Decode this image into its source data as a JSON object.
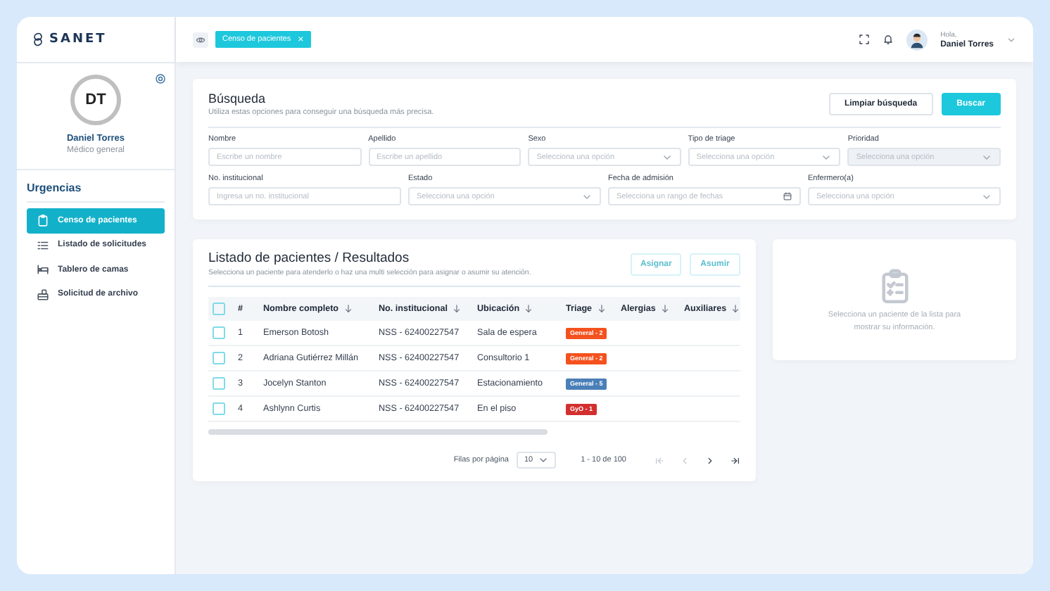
{
  "app": {
    "logo": "SANET"
  },
  "tabs": [
    {
      "label": "Censo de pacientes",
      "selected": true,
      "close": "×"
    }
  ],
  "header": {
    "greeting": "Hola,",
    "user_name": "Daniel Torres"
  },
  "profile": {
    "initials": "DT",
    "name": "Daniel Torres",
    "role": "Médico general"
  },
  "sidebar": {
    "section": "Urgencias",
    "items": [
      {
        "label": "Censo de pacientes",
        "kind": "clipboard",
        "selected": true
      },
      {
        "label": "Listado de solicitudes",
        "kind": "list",
        "selected": false
      },
      {
        "label": "Tablero de camas",
        "kind": "bed",
        "selected": false
      },
      {
        "label": "Solicitud de archivo",
        "kind": "archive",
        "selected": false
      }
    ]
  },
  "search": {
    "title": "Búsqueda",
    "subtitle": "Utiliza estas opciones para conseguir una búsqueda más precisa.",
    "buttons": [
      {
        "label": "Limpiar búsqueda",
        "kind": "secondary"
      },
      {
        "label": "Buscar",
        "kind": "primary"
      }
    ],
    "rows": [
      [
        {
          "label": "Nombre",
          "placeholder": "Escribe un nombre",
          "kind": "text",
          "disabled": false
        },
        {
          "label": "Apellido",
          "placeholder": "Escribe un apellido",
          "kind": "text",
          "disabled": false
        },
        {
          "label": "Sexo",
          "placeholder": "Selecciona una opción",
          "kind": "select",
          "disabled": false
        },
        {
          "label": "Tipo de triage",
          "placeholder": "Selecciona una opción",
          "kind": "select",
          "disabled": false
        },
        {
          "label": "Prioridad",
          "placeholder": "Selecciona una opción",
          "kind": "select",
          "disabled": true
        }
      ],
      [
        {
          "label": "No. institucional",
          "placeholder": "Ingresa un no. institucional",
          "kind": "text",
          "disabled": false
        },
        {
          "label": "Estado",
          "placeholder": "Selecciona una opción",
          "kind": "select",
          "disabled": false
        },
        {
          "label": "Fecha de admisión",
          "placeholder": "Selecciona un rango de fechas",
          "kind": "date",
          "disabled": false
        },
        {
          "label": "Enfermero(a)",
          "placeholder": "Selecciona una opción",
          "kind": "select",
          "disabled": false
        }
      ]
    ]
  },
  "results": {
    "title": "Listado de pacientes / Resultados",
    "subtitle": "Selecciona un paciente para atenderlo o haz una multi selección para asignar o asumir su atención.",
    "actions": [
      {
        "label": "Asignar",
        "disabled": true
      },
      {
        "label": "Asumir",
        "disabled": true
      }
    ],
    "all_checked": false,
    "columns": [
      "#",
      "Nombre completo",
      "No. institucional",
      "Ubicación",
      "Triage",
      "Alergias",
      "Auxiliares"
    ],
    "rows": [
      {
        "checked": false,
        "number": "1",
        "name": "Emerson Botosh",
        "id": "NSS - 62400227547",
        "location": "Sala de espera",
        "triage": {
          "label": "General - 2",
          "color": "#f4511e"
        }
      },
      {
        "checked": false,
        "number": "2",
        "name": "Adriana Gutiérrez Millán",
        "id": "NSS - 62400227547",
        "location": "Consultorio 1",
        "triage": {
          "label": "General - 2",
          "color": "#f4511e"
        }
      },
      {
        "checked": false,
        "number": "3",
        "name": "Jocelyn Stanton",
        "id": "NSS - 62400227547",
        "location": "Estacionamiento",
        "triage": {
          "label": "General - 5",
          "color": "#4a7fb8"
        }
      },
      {
        "checked": false,
        "number": "4",
        "name": "Ashlynn Curtis",
        "id": "NSS - 62400227547",
        "location": "En el piso",
        "triage": {
          "label": "GyO - 1",
          "color": "#d32f2f"
        }
      }
    ],
    "pagination": {
      "rows_label": "Filas por página",
      "rows_per_page": "10",
      "range": "1 - 10 de 100"
    }
  },
  "info": {
    "message": "Selecciona un paciente de la lista para mostrar su información."
  }
}
